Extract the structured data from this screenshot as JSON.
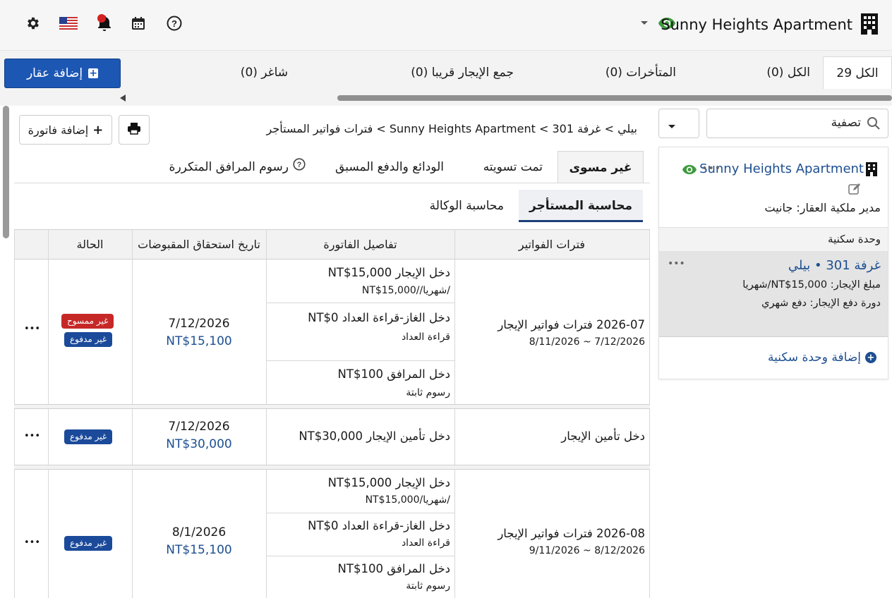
{
  "topbar": {
    "property_name": "Sunny Heights Apartment",
    "icons": [
      "gear-icon",
      "us-flag-icon",
      "bell-icon",
      "calendar-icon",
      "help-icon",
      "chevron-down-icon",
      "eye-icon",
      "building-icon"
    ]
  },
  "tabs": [
    {
      "label": "الكل 29"
    },
    {
      "label": "الكل (0)"
    },
    {
      "label": "المتأخرات (0)"
    },
    {
      "label": "جمع الإيجار قريبا (0)"
    },
    {
      "label": "شاغر (0)"
    }
  ],
  "add_property_label": "إضافة عقار",
  "sidebar": {
    "filter_placeholder": "تصفية",
    "property_name": "Sunny Heights Apartment",
    "manager_line": "مدير ملكية العقار: جانيت",
    "units_header": "وحدة سكنية",
    "unit": {
      "title": "غرفة 301 • بيلي",
      "rent_line": "مبلغ الإيجار: NT$15,000/شهريا",
      "cycle_line": "دورة دفع الإيجار: دفع شهري"
    },
    "add_unit_label": "إضافة وحدة سكنية"
  },
  "main": {
    "breadcrumb": "بيلي > غرفة 301 > Sunny Heights Apartment > فترات فواتير المستأجر",
    "add_invoice_label": "إضافة فاتورة",
    "tabs": [
      {
        "label": "غير مسوى"
      },
      {
        "label": "تمت تسويته"
      },
      {
        "label": "الودائع والدفع المسبق"
      },
      {
        "label": "رسوم المرافق المتكررة"
      }
    ],
    "subtabs": [
      {
        "label": "محاسبة المستأجر"
      },
      {
        "label": "محاسبة الوكالة"
      }
    ],
    "table": {
      "headers": [
        "فترات الفواتير",
        "تفاصيل الفاتورة",
        "تاريخ استحقاق المقبوضات",
        "الحالة"
      ],
      "groups": [
        {
          "period_title": "2026-07 فترات فواتير الإيجار",
          "period_range": "7/12/2026 ~ 8/11/2026",
          "details": [
            {
              "title": "دخل الإيجار NT$15,000",
              "sub": "/شهريا//NT$15,000"
            },
            {
              "title": "دخل الغاز-قراءة العداد NT$0",
              "sub": "قراءة العداد"
            },
            {
              "title": "دخل المرافق NT$100",
              "sub": "رسوم ثابتة"
            }
          ],
          "due_date": "7/12/2026",
          "due_amount": "NT$15,100",
          "badges": [
            "غير ممسوح",
            "غير مدفوع"
          ],
          "more": "•••"
        },
        {
          "period_title": "دخل تأمين الإيجار",
          "details": [
            {
              "title": "دخل تأمين الإيجار NT$30,000"
            }
          ],
          "due_date": "7/12/2026",
          "due_amount": "NT$30,000",
          "badges": [
            "غير مدفوع"
          ],
          "more": "•••"
        },
        {
          "period_title": "2026-08 فترات فواتير الإيجار",
          "period_range": "8/12/2026 ~ 9/11/2026",
          "details": [
            {
              "title": "دخل الإيجار NT$15,000",
              "sub": "/شهريا/NT$15,000"
            },
            {
              "title": "دخل الغاز-قراءة العداد NT$0",
              "sub": "قراءة العداد"
            },
            {
              "title": "دخل المرافق NT$100",
              "sub": "رسوم ثابتة"
            }
          ],
          "due_date": "8/1/2026",
          "due_amount": "NT$15,100",
          "badges": [
            "غير مدفوع"
          ],
          "more": "•••"
        }
      ]
    }
  },
  "colors": {
    "primary": "#1d57b4",
    "badge_red": "#c62828",
    "badge_blue": "#1b4a9a",
    "eye_green": "#3f9a3f",
    "link_blue": "#1d4f91"
  }
}
